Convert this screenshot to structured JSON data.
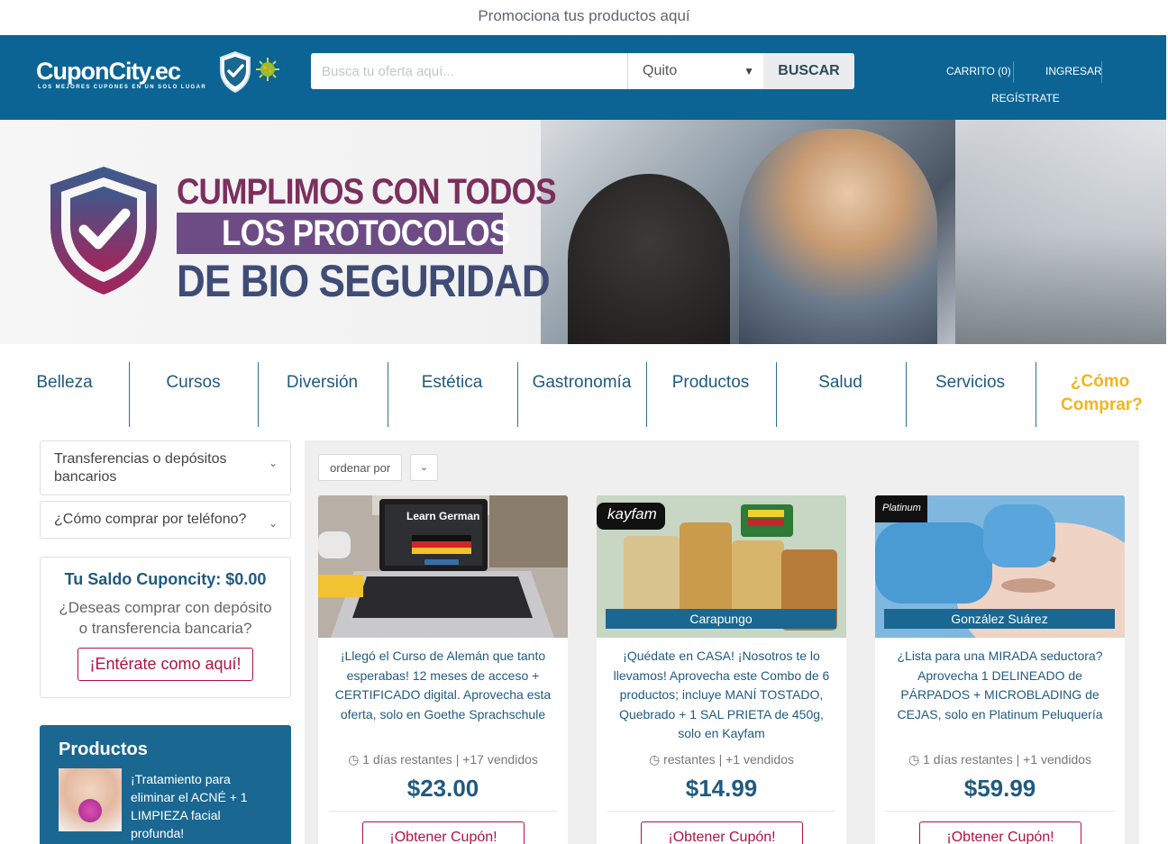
{
  "promo": {
    "text": "Promociona tus productos aquí"
  },
  "header": {
    "logo_text": "CuponCity.ec",
    "logo_tagline": "LOS MEJORES CUPONES EN UN SOLO LUGAR",
    "search_placeholder": "Busca tu oferta aquí...",
    "city_selected": "Quito",
    "search_button": "BUSCAR",
    "cart": "CARRITO (0)",
    "login": "INGRESAR",
    "register": "REGÍSTRATE"
  },
  "banner": {
    "line1": "CUMPLIMOS CON TODOS",
    "line2": "LOS PROTOCOLOS",
    "line3": "DE BIO SEGURIDAD"
  },
  "categories": [
    "Belleza",
    "Cursos",
    "Diversión",
    "Estética",
    "Gastronomía",
    "Productos",
    "Salud",
    "Servicios"
  ],
  "how_to_buy": "¿Cómo Comprar?",
  "sidebar": {
    "accordion": [
      "Transferencias o depósitos bancarios",
      "¿Cómo comprar por teléfono?"
    ],
    "saldo_title": "Tu Saldo Cuponcity: $0.00",
    "saldo_text": "¿Deseas comprar con depósito o transferencia bancaria?",
    "saldo_button": "¡Entérate como aquí!",
    "products_title": "Productos",
    "product_text": "¡Tratamiento para eliminar el ACNÉ + 1 LIMPIEZA facial profunda!"
  },
  "sort": {
    "label": "ordenar por"
  },
  "deals": [
    {
      "location": "",
      "image_caption": "Learn German",
      "description": "¡Llegó el Curso de Alemán que tanto esperabas! 12 meses de acceso + CERTIFICADO digital. Aprovecha esta oferta, solo en Goethe Sprachschule",
      "meta": "1 días restantes | +17 vendidos",
      "price": "$23.00",
      "button": "¡Obtener Cupón!"
    },
    {
      "location": "Carapungo",
      "image_caption": "kayfam",
      "description": "¡Quédate en CASA! ¡Nosotros te lo llevamos! Aprovecha este Combo de 6 productos; incluye MANÍ TOSTADO, Quebrado + 1 SAL PRIETA de 450g, solo en Kayfam",
      "meta": "restantes | +1 vendidos",
      "price": "$14.99",
      "button": "¡Obtener Cupón!"
    },
    {
      "location": "González Suárez",
      "image_caption": "Platinum",
      "description": "¿Lista para una MIRADA seductora? Aprovecha 1 DELINEADO de PÁRPADOS + MICROBLADING de CEJAS, solo en Platinum Peluquería",
      "meta": "1 días restantes | +1 vendidos",
      "price": "$59.99",
      "button": "¡Obtener Cupón!"
    }
  ],
  "colors": {
    "brand": "#0b6494",
    "accent": "#f2b51d",
    "cta": "#b0123f",
    "text_blue": "#1f5a80"
  }
}
